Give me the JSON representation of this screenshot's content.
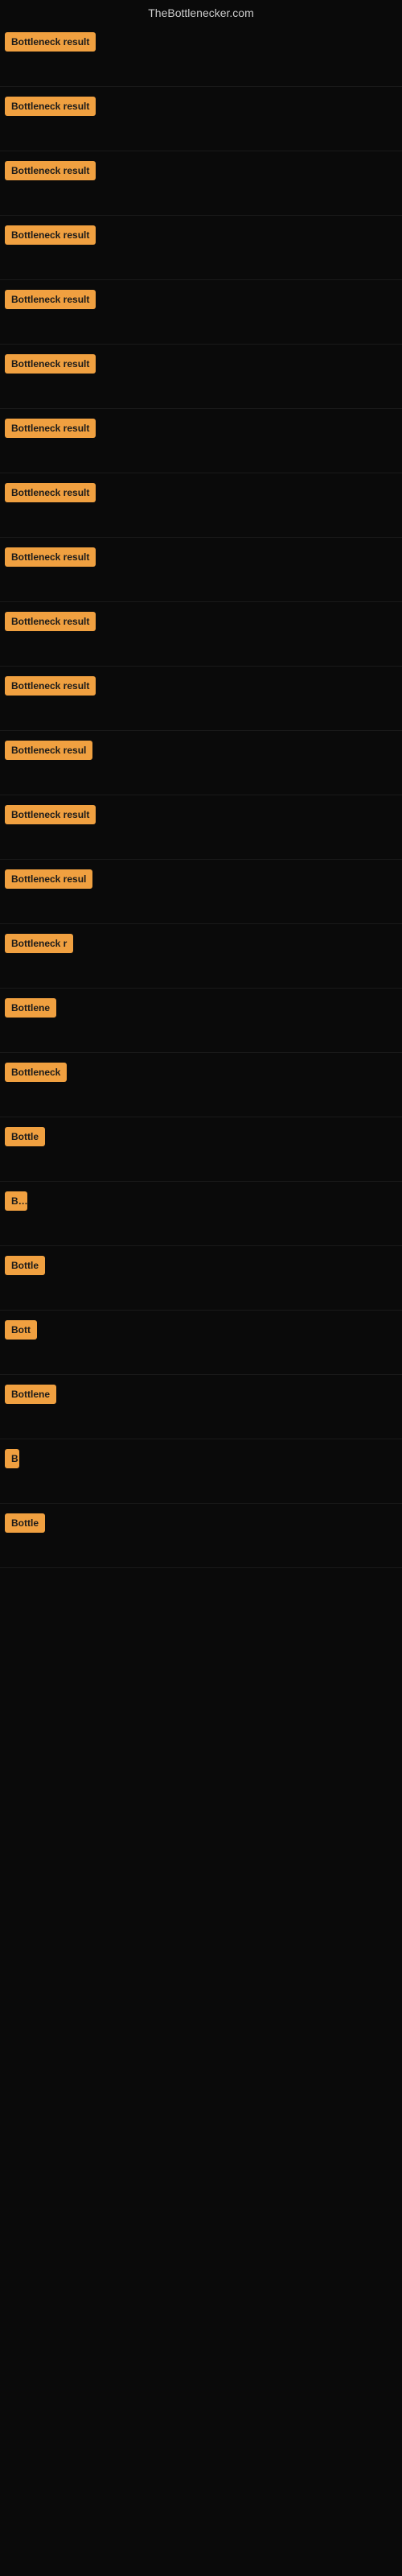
{
  "header": {
    "title": "TheBottlenecker.com"
  },
  "rows": [
    {
      "id": 1,
      "label": "Bottleneck result",
      "width": 130
    },
    {
      "id": 2,
      "label": "Bottleneck result",
      "width": 130
    },
    {
      "id": 3,
      "label": "Bottleneck result",
      "width": 130
    },
    {
      "id": 4,
      "label": "Bottleneck result",
      "width": 130
    },
    {
      "id": 5,
      "label": "Bottleneck result",
      "width": 130
    },
    {
      "id": 6,
      "label": "Bottleneck result",
      "width": 130
    },
    {
      "id": 7,
      "label": "Bottleneck result",
      "width": 130
    },
    {
      "id": 8,
      "label": "Bottleneck result",
      "width": 130
    },
    {
      "id": 9,
      "label": "Bottleneck result",
      "width": 130
    },
    {
      "id": 10,
      "label": "Bottleneck result",
      "width": 130
    },
    {
      "id": 11,
      "label": "Bottleneck result",
      "width": 130
    },
    {
      "id": 12,
      "label": "Bottleneck resul",
      "width": 118
    },
    {
      "id": 13,
      "label": "Bottleneck result",
      "width": 125
    },
    {
      "id": 14,
      "label": "Bottleneck resul",
      "width": 118
    },
    {
      "id": 15,
      "label": "Bottleneck r",
      "width": 88
    },
    {
      "id": 16,
      "label": "Bottlene",
      "width": 70
    },
    {
      "id": 17,
      "label": "Bottleneck",
      "width": 78
    },
    {
      "id": 18,
      "label": "Bottle",
      "width": 55
    },
    {
      "id": 19,
      "label": "Bo",
      "width": 28
    },
    {
      "id": 20,
      "label": "Bottle",
      "width": 55
    },
    {
      "id": 21,
      "label": "Bott",
      "width": 40
    },
    {
      "id": 22,
      "label": "Bottlene",
      "width": 65
    },
    {
      "id": 23,
      "label": "B",
      "width": 18
    },
    {
      "id": 24,
      "label": "Bottle",
      "width": 52
    }
  ]
}
